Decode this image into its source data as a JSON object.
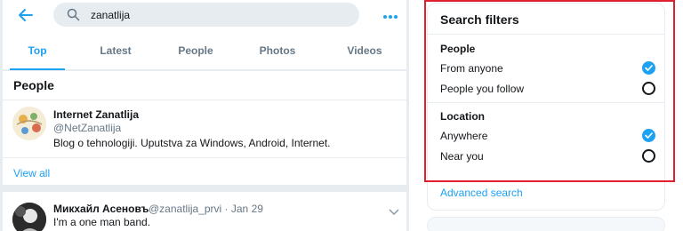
{
  "header": {
    "search_value": "zanatlija",
    "colors": {
      "accent": "#1da1f2",
      "background": "#e6ecf0",
      "text": "#14171a",
      "secondary": "#657786",
      "highlight": "#e0202f"
    }
  },
  "tabs": [
    {
      "label": "Top",
      "active": true
    },
    {
      "label": "Latest",
      "active": false
    },
    {
      "label": "People",
      "active": false
    },
    {
      "label": "Photos",
      "active": false
    },
    {
      "label": "Videos",
      "active": false
    }
  ],
  "people": {
    "heading": "People",
    "user": {
      "name": "Internet Zanatlija",
      "handle": "@NetZanatlija",
      "bio": "Blog o tehnologiji. Uputstva za Windows, Android, Internet."
    },
    "view_all": "View all"
  },
  "tweet": {
    "author": "Микхайл Асеновъ",
    "meta": "@zanatlija_prvi · Jan 29",
    "text": "I'm a one man band."
  },
  "filters": {
    "title": "Search filters",
    "sections": [
      {
        "label": "People",
        "options": [
          {
            "label": "From anyone",
            "selected": true
          },
          {
            "label": "People you follow",
            "selected": false
          }
        ]
      },
      {
        "label": "Location",
        "options": [
          {
            "label": "Anywhere",
            "selected": true
          },
          {
            "label": "Near you",
            "selected": false
          }
        ]
      }
    ],
    "advanced_link": "Advanced search"
  },
  "icons": [
    "back-arrow-icon",
    "search-icon",
    "more-dots-icon",
    "chevron-down-icon",
    "radio-checked-icon",
    "radio-empty-icon"
  ]
}
